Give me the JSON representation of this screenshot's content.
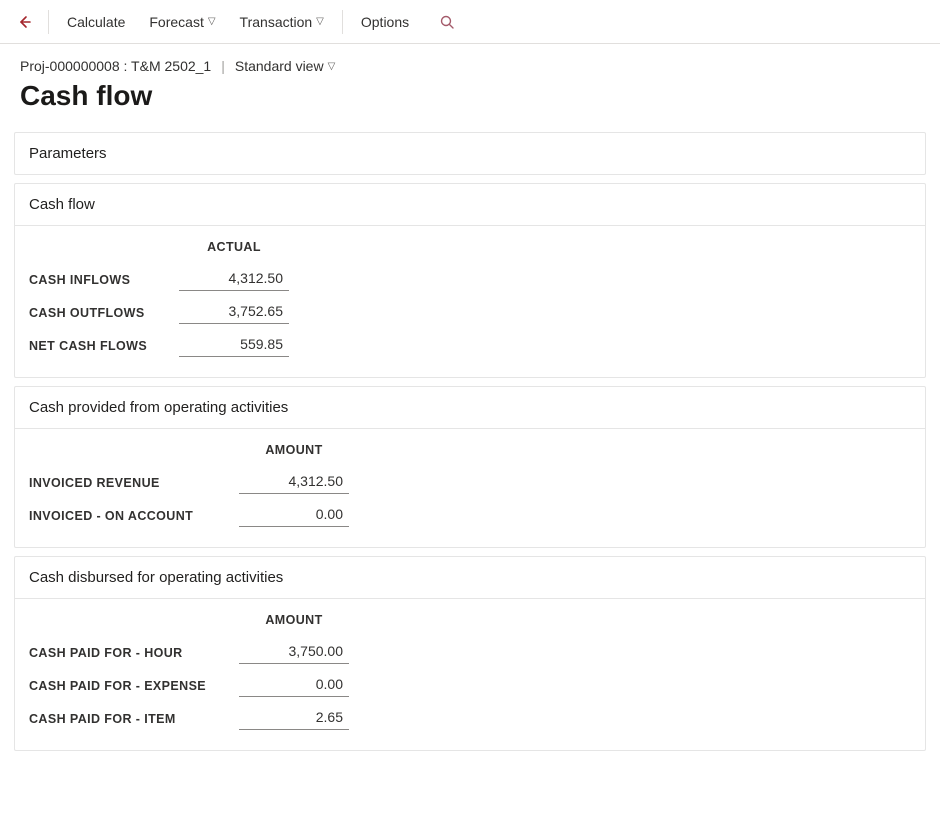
{
  "toolbar": {
    "calculate": "Calculate",
    "forecast": "Forecast",
    "transaction": "Transaction",
    "options": "Options"
  },
  "header": {
    "breadcrumb": "Proj-000000008 : T&M 2502_1",
    "view_label": "Standard view",
    "title": "Cash flow"
  },
  "sections": {
    "parameters": {
      "title": "Parameters"
    },
    "cash_flow": {
      "title": "Cash flow",
      "col_actual": "ACTUAL",
      "rows": {
        "inflows_label": "CASH INFLOWS",
        "inflows_value": "4,312.50",
        "outflows_label": "CASH OUTFLOWS",
        "outflows_value": "3,752.65",
        "net_label": "NET CASH FLOWS",
        "net_value": "559.85"
      }
    },
    "provided": {
      "title": "Cash provided from operating activities",
      "col_amount": "AMOUNT",
      "rows": {
        "invoiced_rev_label": "INVOICED REVENUE",
        "invoiced_rev_value": "4,312.50",
        "invoiced_on_acct_label": "INVOICED - ON ACCOUNT",
        "invoiced_on_acct_value": "0.00"
      }
    },
    "disbursed": {
      "title": "Cash disbursed for operating activities",
      "col_amount": "AMOUNT",
      "rows": {
        "hour_label": "CASH PAID FOR - HOUR",
        "hour_value": "3,750.00",
        "expense_label": "CASH PAID FOR - EXPENSE",
        "expense_value": "0.00",
        "item_label": "CASH PAID FOR - ITEM",
        "item_value": "2.65"
      }
    }
  }
}
